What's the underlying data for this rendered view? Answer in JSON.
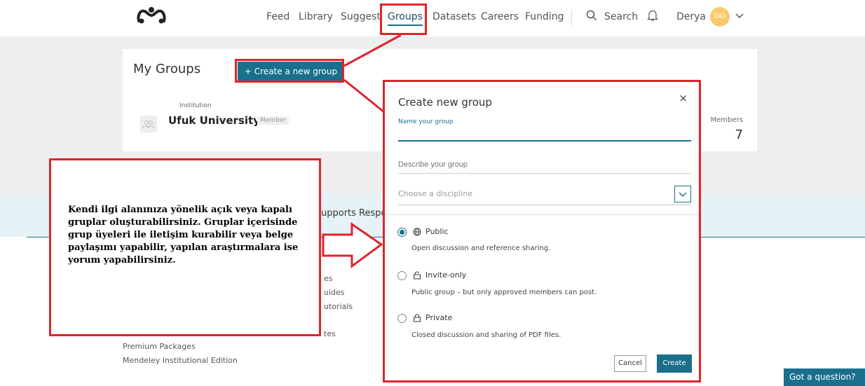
{
  "nav": {
    "items": [
      "Feed",
      "Library",
      "Suggest",
      "Groups",
      "Datasets",
      "Careers",
      "Funding"
    ],
    "search": "Search",
    "user_name": "Derya",
    "user_initials": "DO"
  },
  "my_groups": {
    "title": "My Groups",
    "create_button": "+ Create a new group",
    "institution_label": "Institution",
    "institution_name": "Ufuk University",
    "member_badge": "Member",
    "members_label": "Members",
    "members_count": "7"
  },
  "strip_text": "upports Respo",
  "footer_links": [
    "es",
    "uides",
    "utorials",
    "tes",
    "Premium Packages",
    "Mendeley Institutional Edition"
  ],
  "annotation_text": "Kendi ilgi alanınıza yönelik açık veya kapalı gruplar oluşturabilirsiniz. Gruplar içerisinde grup üyeleri ile iletişim kurabilir veya belge paylaşımı yapabilir, yapılan araştırmalara ise yorum yapabilirsiniz.",
  "modal": {
    "title": "Create new group",
    "close": "×",
    "name_label": "Name your group",
    "name_value": "",
    "describe_placeholder": "Describe your group",
    "discipline_placeholder": "Choose a discipline",
    "options": [
      {
        "label": "Public",
        "desc": "Open discussion and reference sharing.",
        "selected": true,
        "icon": "globe-icon"
      },
      {
        "label": "Invite-only",
        "desc": "Public group – but only approved members can post.",
        "selected": false,
        "icon": "lock-open-icon"
      },
      {
        "label": "Private",
        "desc": "Closed discussion and sharing of PDF files.",
        "selected": false,
        "icon": "lock-icon"
      }
    ],
    "cancel": "Cancel",
    "create": "Create"
  },
  "help_button": "Got a question?",
  "colors": {
    "accent": "#1a6f8c",
    "annotation": "#e1232b",
    "avatar": "#f7cb6b"
  }
}
